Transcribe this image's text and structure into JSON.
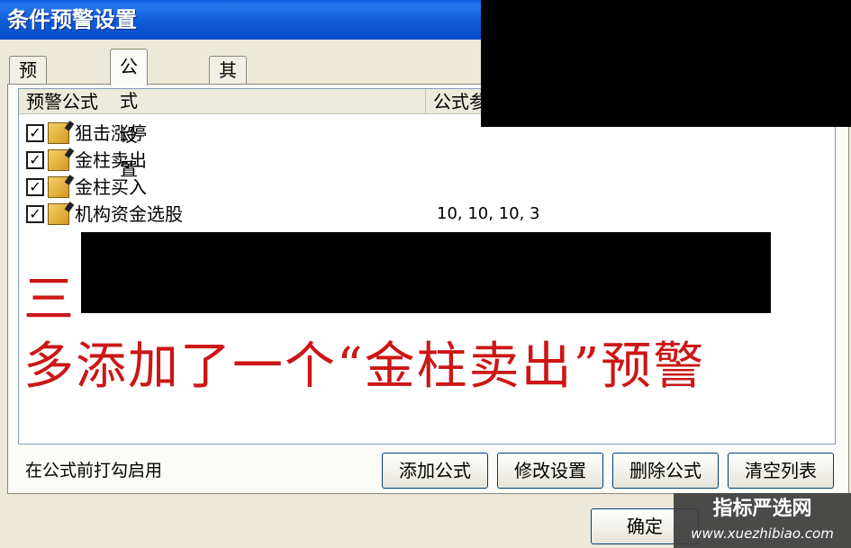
{
  "window": {
    "title": "条件预警设置"
  },
  "tabs": [
    {
      "label": "预警品种",
      "active": false
    },
    {
      "label": "公式设置",
      "active": true
    },
    {
      "label": "其它设置",
      "active": false
    }
  ],
  "list": {
    "columns": [
      "预警公式",
      "公式参"
    ],
    "rows": [
      {
        "name": "狙击涨停",
        "params": "",
        "checked": true
      },
      {
        "name": "金柱卖出",
        "params": "",
        "checked": true
      },
      {
        "name": "金柱买入",
        "params": "",
        "checked": true
      },
      {
        "name": "机构资金选股",
        "params": "10, 10, 10, 3",
        "checked": true
      }
    ]
  },
  "annotation": {
    "line1": "三",
    "line2": "多添加了一个“金柱卖出”预警"
  },
  "footer": {
    "hint": "在公式前打勾启用",
    "buttons": {
      "add": "添加公式",
      "modify": "修改设置",
      "delete": "删除公式",
      "clear": "清空列表"
    },
    "ok": "确定"
  },
  "watermark": {
    "name": "指标严选网",
    "url": "www.xuezhibiao.com"
  },
  "colors": {
    "titlebar": "#0a5be0",
    "annotation": "#cc1616"
  },
  "icons": {
    "checkbox": "check-mark",
    "formula": "formula-icon"
  }
}
